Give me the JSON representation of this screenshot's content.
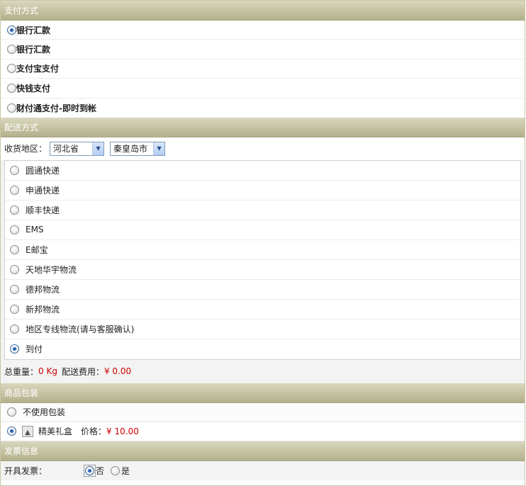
{
  "payment": {
    "title": "支付方式",
    "options": [
      {
        "label": "银行汇款",
        "checked": true
      },
      {
        "label": "银行汇款",
        "checked": false
      },
      {
        "label": "支付宝支付",
        "checked": false
      },
      {
        "label": "快钱支付",
        "checked": false
      },
      {
        "label": "财付通支付-即时到帐",
        "checked": false
      }
    ]
  },
  "shipping": {
    "title": "配送方式",
    "region_label": "收货地区：",
    "province": "河北省",
    "city": "秦皇岛市",
    "options": [
      {
        "label": "圆通快递",
        "checked": false
      },
      {
        "label": "申通快递",
        "checked": false
      },
      {
        "label": "顺丰快递",
        "checked": false
      },
      {
        "label": "EMS",
        "checked": false
      },
      {
        "label": "E邮宝",
        "checked": false
      },
      {
        "label": "天地华宇物流",
        "checked": false
      },
      {
        "label": "德邦物流",
        "checked": false
      },
      {
        "label": "新邦物流",
        "checked": false
      },
      {
        "label": "地区专线物流(请与客服确认)",
        "checked": false
      },
      {
        "label": "到付",
        "checked": true
      }
    ],
    "weight_label": "总重量：",
    "weight_value": "0 Kg",
    "fee_label": "配送费用：",
    "fee_value": "¥ 0.00"
  },
  "packaging": {
    "title": "商品包装",
    "none_label": "不使用包装",
    "gift_label": "精美礼盒",
    "price_label": "价格：",
    "price_value": "¥ 10.00"
  },
  "invoice": {
    "title": "发票信息",
    "label": "开具发票：",
    "no_label": "否",
    "yes_label": "是"
  },
  "colors": {
    "header_top": "#d9d7bd",
    "header_bottom": "#b3b08b",
    "price_red": "#cc0000"
  }
}
